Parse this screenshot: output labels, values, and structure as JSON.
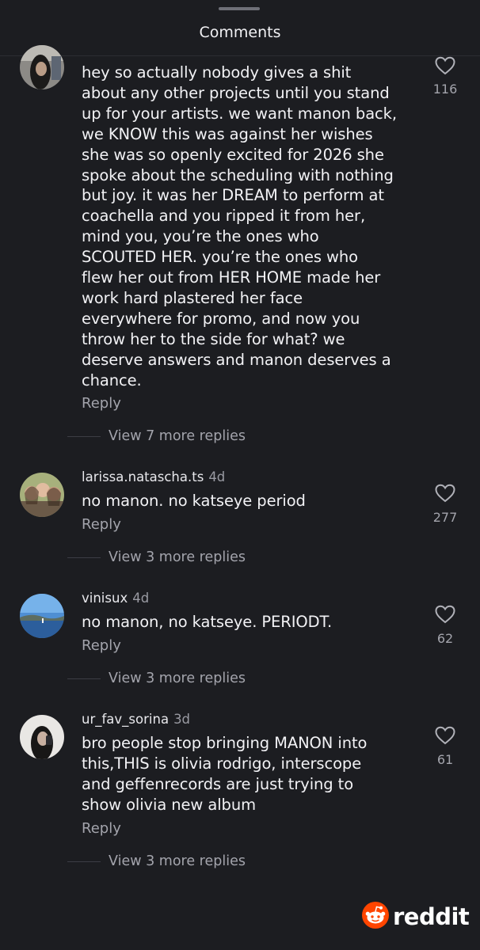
{
  "header": {
    "title": "Comments"
  },
  "comments": [
    {
      "username": "",
      "time": "",
      "text_lines": [
        "hey so actually nobody gives a shit",
        "about any other projects until you stand",
        "up for your artists. we want manon back,",
        "we KNOW this was against her wishes",
        "she was so openly excited for 2026 she",
        "spoke about the scheduling with nothing",
        "but joy. it was her DREAM to perform at",
        "coachella and you ripped it from her,",
        "mind you, you’re the ones who",
        "SCOUTED HER. you’re the ones who",
        "flew her out from HER HOME made her",
        "work hard plastered her face",
        "everywhere for promo, and now you",
        "throw her to the side for what? we",
        "deserve answers and manon deserves a",
        "chance."
      ],
      "reply_label": "Reply",
      "likes": "116",
      "view_more": "View 7 more replies"
    },
    {
      "username": "larissa.natascha.ts",
      "time": "4d",
      "text_lines": [
        "no manon. no katseye period"
      ],
      "reply_label": "Reply",
      "likes": "277",
      "view_more": "View 3 more replies"
    },
    {
      "username": "vinisux",
      "time": "4d",
      "text_lines": [
        "no manon, no katseye. PERIODT."
      ],
      "reply_label": "Reply",
      "likes": "62",
      "view_more": "View 3 more replies"
    },
    {
      "username": "ur_fav_sorina",
      "time": "3d",
      "text_lines": [
        "bro people stop bringing MANON into",
        "this,THIS is olivia rodrigo, interscope",
        "and geffenrecords are just trying to",
        "show olivia new album"
      ],
      "reply_label": "Reply",
      "likes": "61",
      "view_more": "View 3 more replies"
    }
  ],
  "watermark": {
    "wordmark": "reddit",
    "icon": "reddit-snoo-icon"
  },
  "colors": {
    "background": "#1c1d21",
    "text_primary": "#f2f2f5",
    "text_secondary": "#a3a4ac",
    "reddit_orange": "#ff4500"
  }
}
